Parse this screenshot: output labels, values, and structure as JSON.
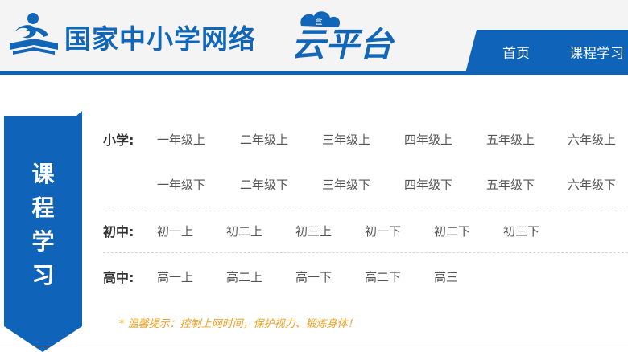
{
  "header": {
    "site_title": "国家中小学网络",
    "brand_text": "云平台",
    "logo_badge": "盒"
  },
  "nav": {
    "home": "首页",
    "courses": "课程学习"
  },
  "banner": {
    "title": [
      "课",
      "程",
      "学",
      "习"
    ]
  },
  "sections": {
    "primary": {
      "label": "小学:",
      "upper": [
        "一年级上",
        "二年级上",
        "三年级上",
        "四年级上",
        "五年级上",
        "六年级上"
      ],
      "lower": [
        "一年级下",
        "二年级下",
        "三年级下",
        "四年级下",
        "五年级下",
        "六年级下"
      ]
    },
    "junior": {
      "label": "初中:",
      "items": [
        "初一上",
        "初二上",
        "初三上",
        "初一下",
        "初二下",
        "初三下"
      ]
    },
    "senior": {
      "label": "高中:",
      "items": [
        "高一上",
        "高二上",
        "高一下",
        "高二下",
        "高三"
      ]
    }
  },
  "tip": "* 温馨提示：控制上网时间，保护视力、锻炼身体！",
  "colors": {
    "brand_blue": "#0f64b9",
    "tip_orange": "#f0a020"
  }
}
